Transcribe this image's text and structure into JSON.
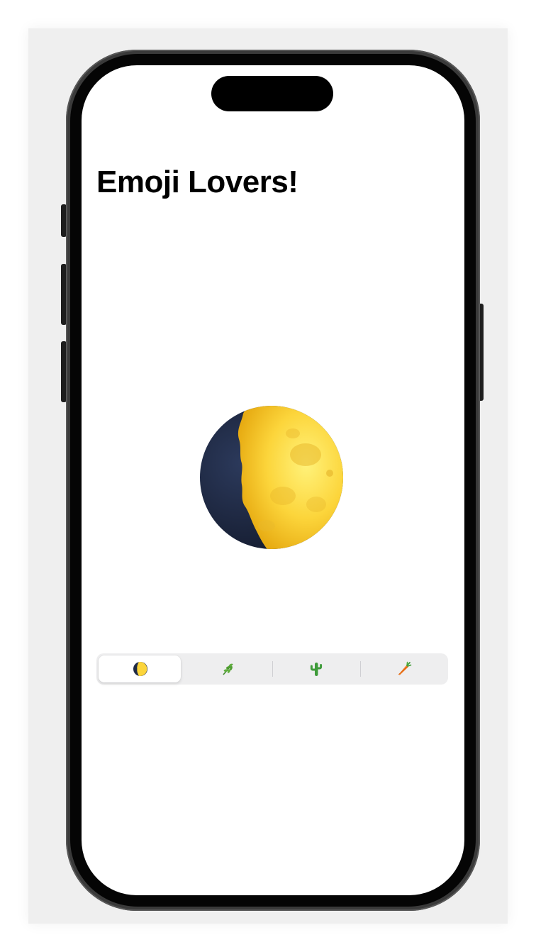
{
  "screen": {
    "title": "Emoji Lovers!"
  },
  "hero": {
    "emoji": "🌔",
    "icon": "waxing-gibbous-moon-icon"
  },
  "segmented_control": {
    "selected_index": 0,
    "segments": [
      {
        "emoji": "🌔",
        "icon": "moon-icon"
      },
      {
        "emoji": "🌿",
        "icon": "herb-icon"
      },
      {
        "emoji": "🌵",
        "icon": "cactus-icon"
      },
      {
        "emoji": "🥕",
        "icon": "carrot-icon"
      }
    ]
  },
  "colors": {
    "moon_light": "#fcd53b",
    "moon_dark": "#1f2a44",
    "segment_bg": "#eeeeef",
    "segment_selected": "#ffffff"
  }
}
